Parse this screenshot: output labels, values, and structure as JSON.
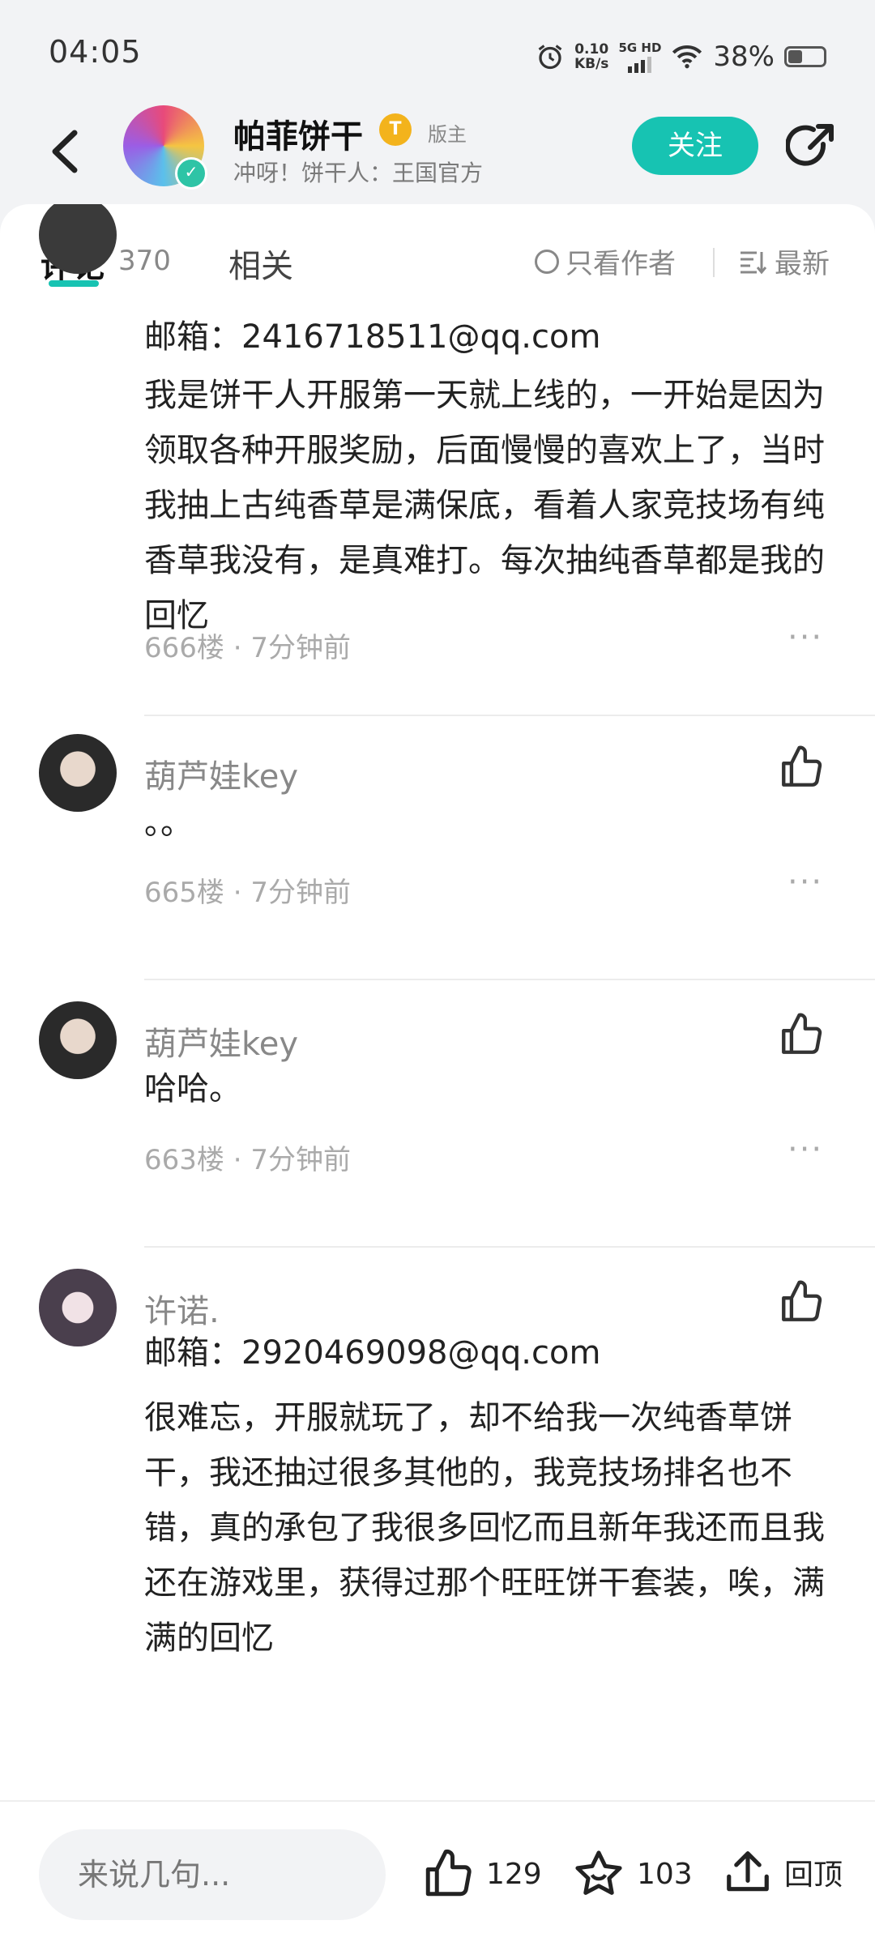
{
  "status": {
    "time": "04:05",
    "net_speed": "0.10",
    "net_unit": "KB/s",
    "net_type": "5G HD",
    "battery": "38%",
    "battery_level": 0.38
  },
  "header": {
    "name": "帕菲饼干",
    "level_badge": "T",
    "role": "版主",
    "subtitle": "冲呀！饼干人：王国官方",
    "follow_label": "关注"
  },
  "tabs": {
    "comment_label": "评论",
    "comment_count": "370",
    "related_label": "相关",
    "author_only": "只看作者",
    "sort": "最新"
  },
  "comments": [
    {
      "user": "",
      "email": "邮箱：2416718511@qq.com",
      "text": "我是饼干人开服第一天就上线的，一开始是因为领取各种开服奖励，后面慢慢的喜欢上了，当时我抽上古纯香草是满保底，看着人家竞技场有纯香草我没有，是真难打。每次抽纯香草都是我的回忆",
      "meta": "666楼 · 7分钟前"
    },
    {
      "user": "葫芦娃key",
      "text": "。。",
      "meta": "665楼 · 7分钟前"
    },
    {
      "user": "葫芦娃key",
      "text": "哈哈。",
      "meta": "663楼 · 7分钟前"
    },
    {
      "user": "许诺.",
      "email": "邮箱：2920469098@qq.com",
      "text": "很难忘，开服就玩了，却不给我一次纯香草饼干，我还抽过很多其他的，我竞技场排名也不错，真的承包了我很多回忆而且新年我还而且我还在游戏里，获得过那个旺旺饼干套装，唉，满满的回忆"
    }
  ],
  "bottom": {
    "input_placeholder": "来说几句...",
    "likes": "129",
    "favorites": "103",
    "top_label": "回顶"
  }
}
